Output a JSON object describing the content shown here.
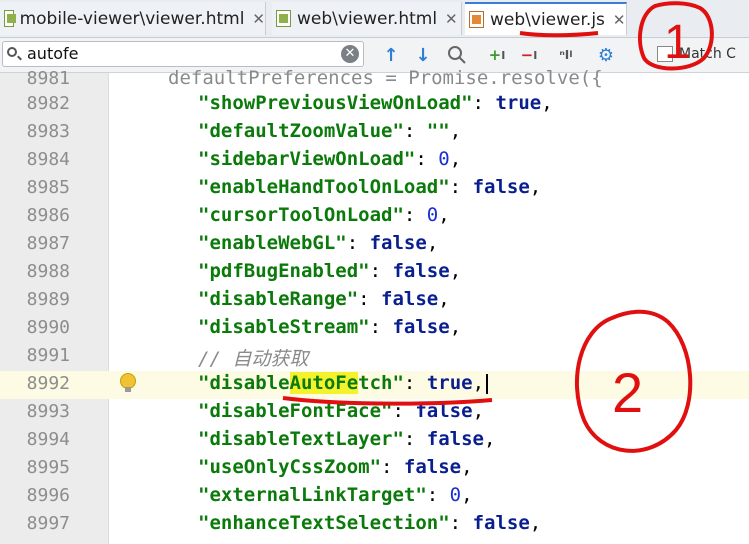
{
  "tabs": [
    {
      "label": "mobile-viewer\\viewer.html",
      "icon": "html-file-icon",
      "active": false
    },
    {
      "label": "web\\viewer.html",
      "icon": "html-file-icon",
      "active": false
    },
    {
      "label": "web\\viewer.js",
      "icon": "js-file-icon",
      "active": true
    }
  ],
  "search": {
    "value": "autofe",
    "match_case_label": "Match C"
  },
  "toolbar_icons": [
    "search-icon",
    "clear-search-icon",
    "previous-occurrence-icon",
    "next-occurrence-icon",
    "find-all-icon",
    "add-occurrence-icon",
    "remove-occurrence-icon",
    "select-all-occurrences-icon",
    "settings-icon"
  ],
  "code": {
    "top_line": {
      "num": "8981",
      "text": "defaultPreferences = Promise.resolve({"
    },
    "lines": [
      {
        "num": "8982",
        "key": "\"showPreviousViewOnLoad\"",
        "value": "true",
        "vtype": "kw"
      },
      {
        "num": "8983",
        "key": "\"defaultZoomValue\"",
        "value": "\"\"",
        "vtype": "key"
      },
      {
        "num": "8984",
        "key": "\"sidebarViewOnLoad\"",
        "value": "0",
        "vtype": "num"
      },
      {
        "num": "8985",
        "key": "\"enableHandToolOnLoad\"",
        "value": "false",
        "vtype": "kw"
      },
      {
        "num": "8986",
        "key": "\"cursorToolOnLoad\"",
        "value": "0",
        "vtype": "num"
      },
      {
        "num": "8987",
        "key": "\"enableWebGL\"",
        "value": "false",
        "vtype": "kw"
      },
      {
        "num": "8988",
        "key": "\"pdfBugEnabled\"",
        "value": "false",
        "vtype": "kw"
      },
      {
        "num": "8989",
        "key": "\"disableRange\"",
        "value": "false",
        "vtype": "kw"
      },
      {
        "num": "8990",
        "key": "\"disableStream\"",
        "value": "false",
        "vtype": "kw"
      },
      {
        "num": "8991",
        "comment": "// 自动获取"
      },
      {
        "num": "8992",
        "key_pre": "\"disable",
        "key_hl": "AutoFe",
        "key_post": "tch\"",
        "value": "true",
        "vtype": "kw",
        "current": true
      },
      {
        "num": "8993",
        "key": "\"disableFontFace\"",
        "value": "false",
        "vtype": "kw"
      },
      {
        "num": "8994",
        "key": "\"disableTextLayer\"",
        "value": "false",
        "vtype": "kw"
      },
      {
        "num": "8995",
        "key": "\"useOnlyCssZoom\"",
        "value": "false",
        "vtype": "kw"
      },
      {
        "num": "8996",
        "key": "\"externalLinkTarget\"",
        "value": "0",
        "vtype": "num"
      },
      {
        "num": "8997",
        "key": "\"enhanceTextSelection\"",
        "value": "false",
        "vtype": "kw"
      }
    ]
  },
  "annotations": {
    "label_1": "1",
    "label_2": "2",
    "color": "#e01010"
  }
}
